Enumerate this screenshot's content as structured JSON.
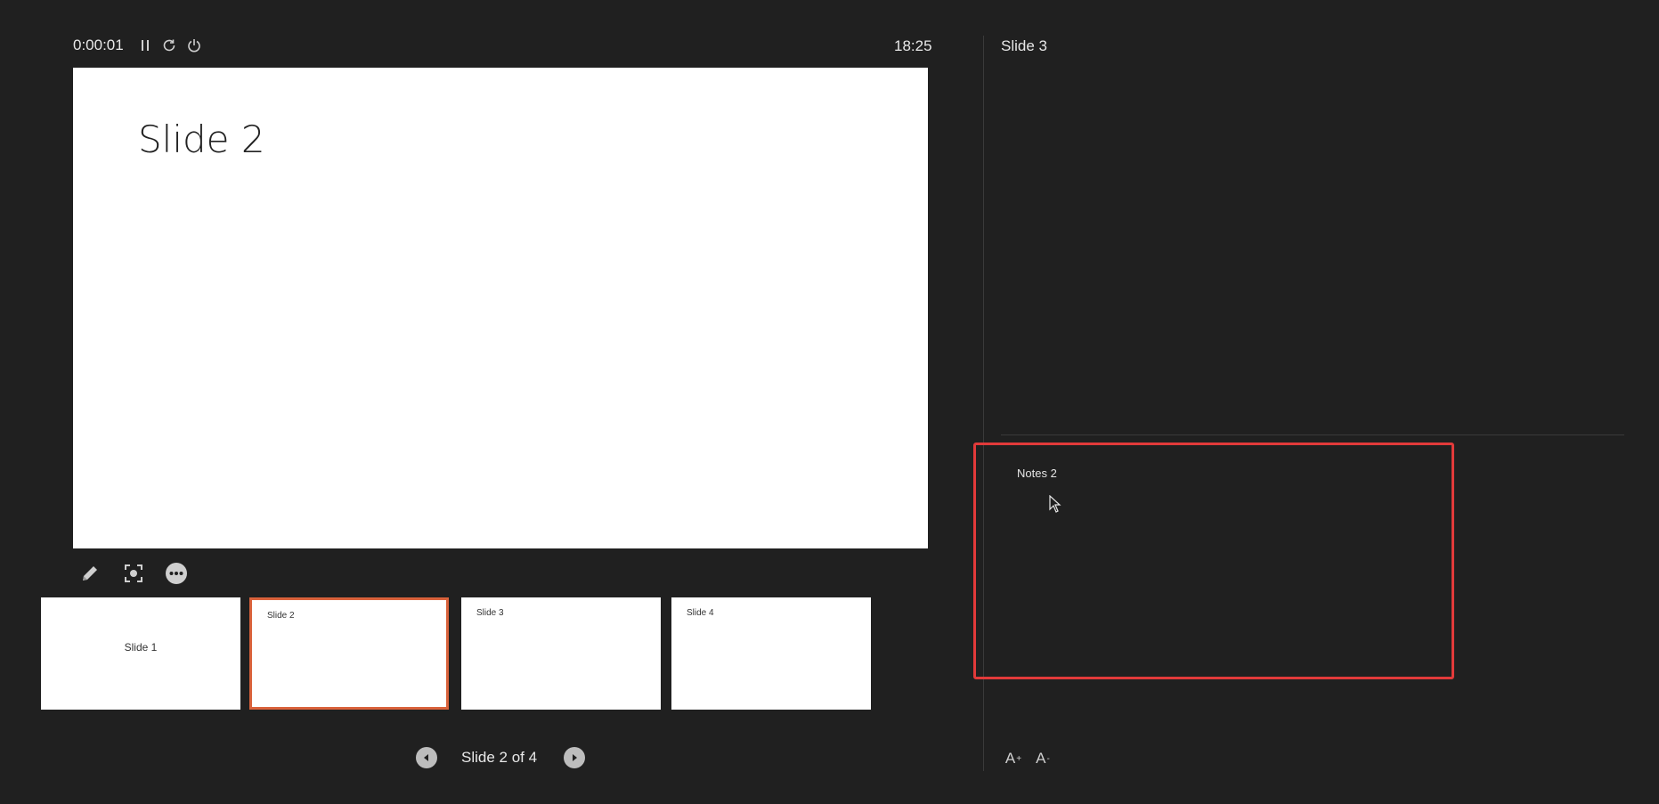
{
  "top_bar": {
    "timer": "0:00:01",
    "clock": "18:25",
    "icons": [
      "pause-icon",
      "restart-icon",
      "power-icon"
    ]
  },
  "main_slide": {
    "title": "Slide 2"
  },
  "tools": [
    "pen-icon",
    "zoom-focus-icon",
    "more-icon"
  ],
  "thumbnails": [
    {
      "label": "Slide 1",
      "selected": false
    },
    {
      "label": "Slide 2",
      "selected": true
    },
    {
      "label": "Slide 3",
      "selected": false
    },
    {
      "label": "Slide 4",
      "selected": false
    }
  ],
  "navigation": {
    "label": "Slide 2 of 4"
  },
  "next_slide": {
    "label": "Slide 3"
  },
  "notes": {
    "text": "Notes 2"
  },
  "font_controls": {
    "increase_label": "A",
    "increase_sup": "+",
    "decrease_label": "A",
    "decrease_sup": "-"
  },
  "colors": {
    "background": "#202020",
    "selected_border": "#d9623b",
    "notes_highlight": "#e23a3a"
  }
}
